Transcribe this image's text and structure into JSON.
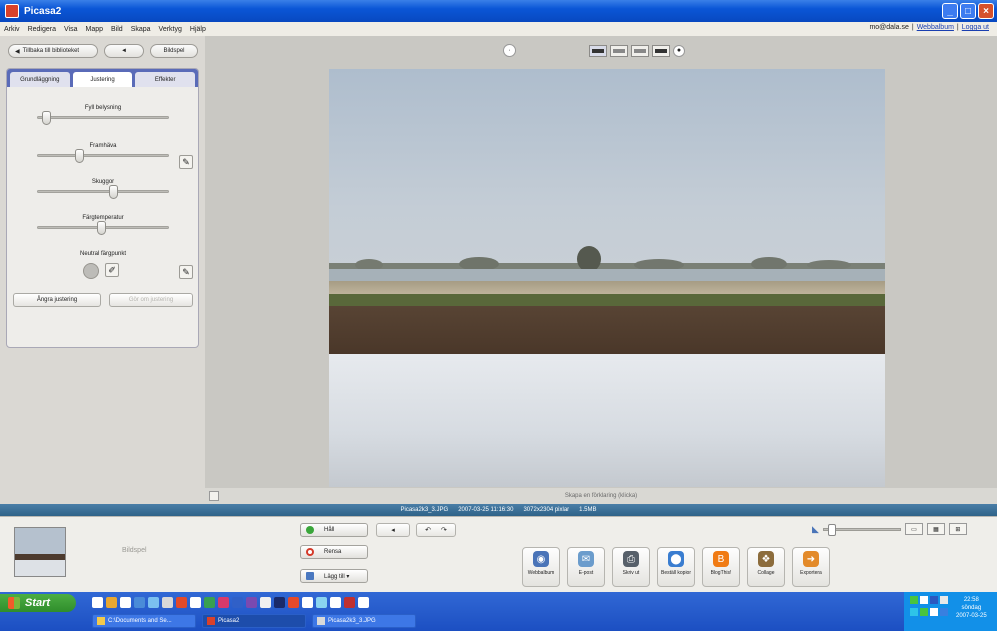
{
  "window": {
    "title": "Picasa2"
  },
  "menu": {
    "items": [
      "Arkiv",
      "Redigera",
      "Visa",
      "Mapp",
      "Bild",
      "Skapa",
      "Verktyg",
      "Hjälp"
    ],
    "account_email": "mo@dala.se",
    "links": [
      "Webbalbum",
      "Logga ut"
    ]
  },
  "nav": {
    "back_label": "Tillbaka till biblioteket",
    "prev_label": "◄",
    "next_label": "Bildspel"
  },
  "tabs": [
    "Grundläggning",
    "Justering",
    "Effekter"
  ],
  "sliders": [
    {
      "label": "Fyll belysning",
      "value": 0.03
    },
    {
      "label": "Framhäva",
      "value": 0.3
    },
    {
      "label": "Skuggor",
      "value": 0.58
    },
    {
      "label": "Färgtemperatur",
      "value": 0.48
    }
  ],
  "neutral_label": "Neutral färgpunkt",
  "buttons": {
    "undo_adjust": "Ångra justering",
    "redo_adjust": "Gör om justering"
  },
  "caption_placeholder": "Skapa en förklaring (klicka)",
  "info": {
    "filename": "Picasa2k3_3.JPG",
    "datetime": "2007-03-25 11:16:30",
    "dimensions": "3072x2304 pixlar",
    "size": "1.5MB"
  },
  "tray": {
    "label": "Bildspel",
    "hold_label": "Håll",
    "remove_label": "Rensa",
    "add_label": "Lägg till ▾",
    "rotate_left": "↶",
    "rotate_right": "↷",
    "rotate_back": "◂"
  },
  "actions": [
    {
      "label": "Webbalbum",
      "icon": "globe-icon",
      "color": "#4a74b8",
      "glyph": "◉"
    },
    {
      "label": "E-post",
      "icon": "email-icon",
      "color": "#6b9ccc",
      "glyph": "✉"
    },
    {
      "label": "Skriv ut",
      "icon": "printer-icon",
      "color": "#57606a",
      "glyph": "⎙"
    },
    {
      "label": "Beställ kopior",
      "icon": "order-prints-icon",
      "color": "#3a7dd0",
      "glyph": "⬤"
    },
    {
      "label": "BlogThis!",
      "icon": "blogger-icon",
      "color": "#f07b14",
      "glyph": "B"
    },
    {
      "label": "Collage",
      "icon": "collage-icon",
      "color": "#8c6c3c",
      "glyph": "❖"
    },
    {
      "label": "Exportera",
      "icon": "export-icon",
      "color": "#e38a2a",
      "glyph": "➜"
    }
  ],
  "zoom": {
    "level": 0.05
  },
  "taskbar": {
    "start_label": "Start",
    "tasks": [
      "C:\\Documents and Se...",
      "Picasa2",
      "Picasa2k3_3.JPG"
    ],
    "clock_time": "22:58",
    "clock_day": "söndag",
    "clock_date": "2007-03-25"
  }
}
